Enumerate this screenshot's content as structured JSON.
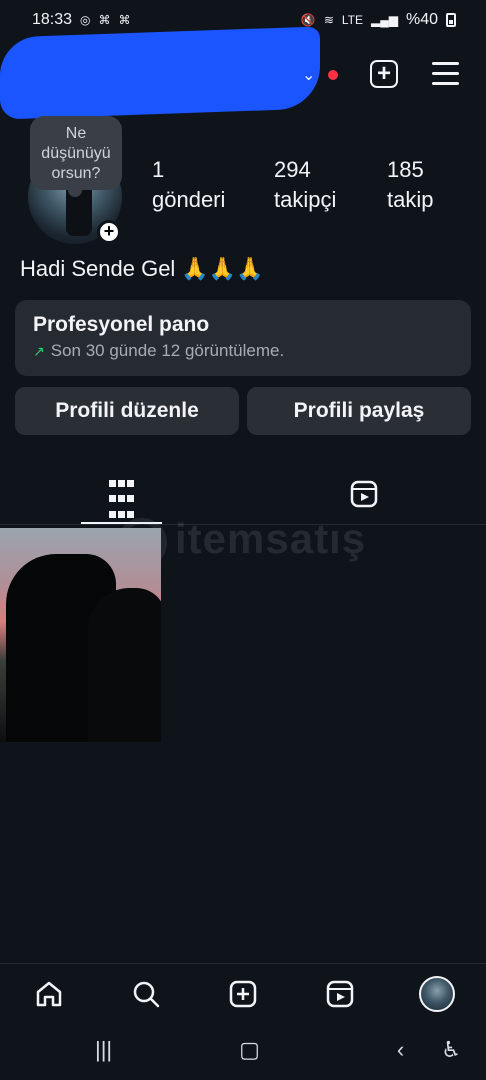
{
  "status_bar": {
    "time": "18:33",
    "left_icons": [
      "instagram-icon",
      "discord-icon",
      "discord-icon"
    ],
    "right_text": "%40",
    "network": "LTE"
  },
  "header": {
    "dropdown_icon": "chevron-down-icon",
    "notification_color": "#ff3040",
    "add_label": "+",
    "menu_icon": "hamburger-menu-icon"
  },
  "profile": {
    "note": "Ne düşünüyü orsun?",
    "stats": [
      {
        "value": "1",
        "label": "gönderi"
      },
      {
        "value": "294",
        "label": "takipçi"
      },
      {
        "value": "185",
        "label": "takip"
      }
    ],
    "bio": "Hadi Sende Gel 🙏🙏🙏"
  },
  "pro_dashboard": {
    "title": "Profesyonel pano",
    "subtitle": "Son 30 günde 12 görüntüleme."
  },
  "actions": {
    "edit": "Profili düzenle",
    "share": "Profili paylaş"
  },
  "tabs": {
    "grid_icon": "grid-icon",
    "reels_icon": "reels-icon"
  },
  "watermark": "itemsatış",
  "bottom_nav": {
    "items": [
      "home-icon",
      "search-icon",
      "create-icon",
      "reels-icon",
      "profile-avatar"
    ]
  }
}
